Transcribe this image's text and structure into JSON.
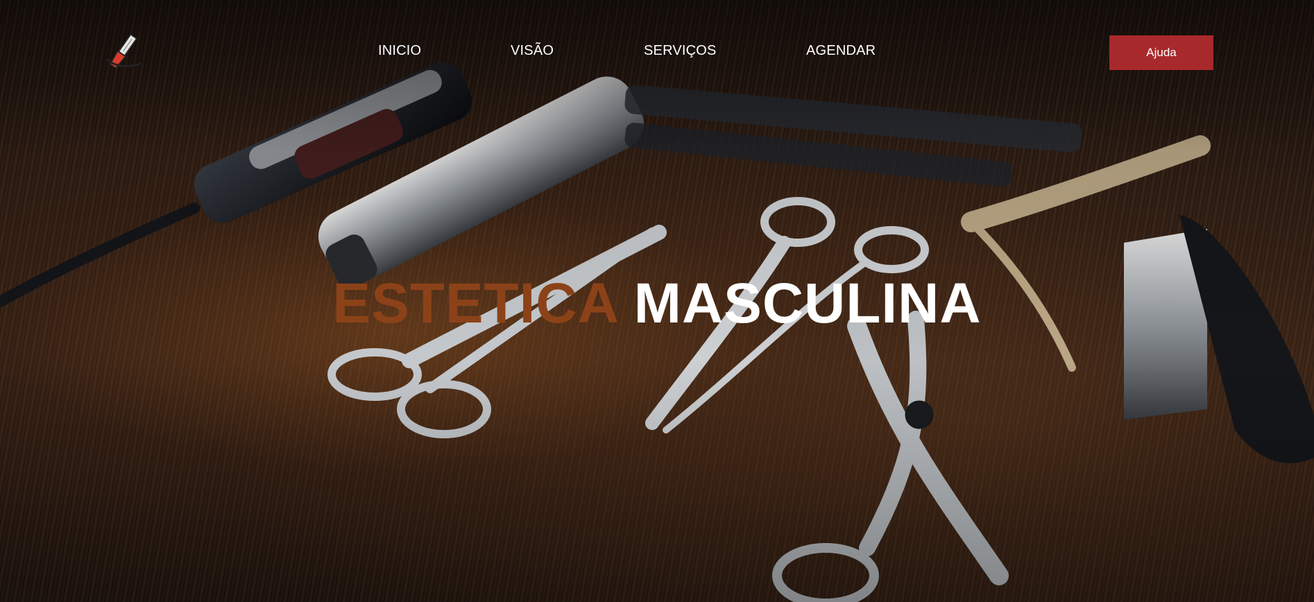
{
  "logo": {
    "icon": "razor-icon",
    "colors": {
      "blade": "#e7e7e7",
      "handle": "#d93b2b"
    }
  },
  "nav": {
    "items": [
      {
        "id": "inicio",
        "label": "INICIO"
      },
      {
        "id": "visao",
        "label": "VISÃO"
      },
      {
        "id": "servicos",
        "label": "SERVIÇOS"
      },
      {
        "id": "agendar",
        "label": "AGENDAR"
      }
    ],
    "help_label": "Ajuda"
  },
  "hero": {
    "title_accent": "ESTETICA",
    "title_main": "MASCULINA",
    "background": "barber tools on wooden table",
    "colors": {
      "accent": "#8c4218",
      "button": "#a8292b",
      "text": "#ffffff"
    }
  }
}
